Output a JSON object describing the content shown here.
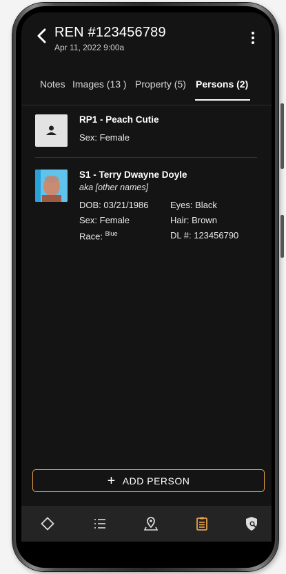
{
  "header": {
    "title": "REN #123456789",
    "subtitle": "Apr 11, 2022 9:00a"
  },
  "tabs": [
    {
      "label": "Notes"
    },
    {
      "label": "Images (13 )"
    },
    {
      "label": "Property (5)"
    },
    {
      "label": "Persons (2)",
      "active": true
    }
  ],
  "persons": [
    {
      "name": "RP1 - Peach Cutie",
      "sex_label": "Sex:",
      "sex": "Female"
    },
    {
      "name": "S1 - Terry Dwayne Doyle",
      "aka": "aka [other names]",
      "dob_label": "DOB:",
      "dob": "03/21/1986",
      "eyes_label": "Eyes:",
      "eyes": "Black",
      "sex_label": "Sex:",
      "sex": "Female",
      "hair_label": "Hair:",
      "hair": "Brown",
      "race_label": "Race:",
      "race": "Blue",
      "dl_label": "DL #:",
      "dl": "123456790"
    }
  ],
  "add_person_label": "ADD PERSON",
  "nav": [
    {
      "icon": "diamond-icon"
    },
    {
      "icon": "list-icon"
    },
    {
      "icon": "map-pin-icon"
    },
    {
      "icon": "clipboard-icon",
      "active": true,
      "color": "#e8a24a"
    },
    {
      "icon": "shield-search-icon"
    }
  ],
  "colors": {
    "accent": "#e8a24a",
    "background": "#141414",
    "nav_bg": "#242424"
  }
}
